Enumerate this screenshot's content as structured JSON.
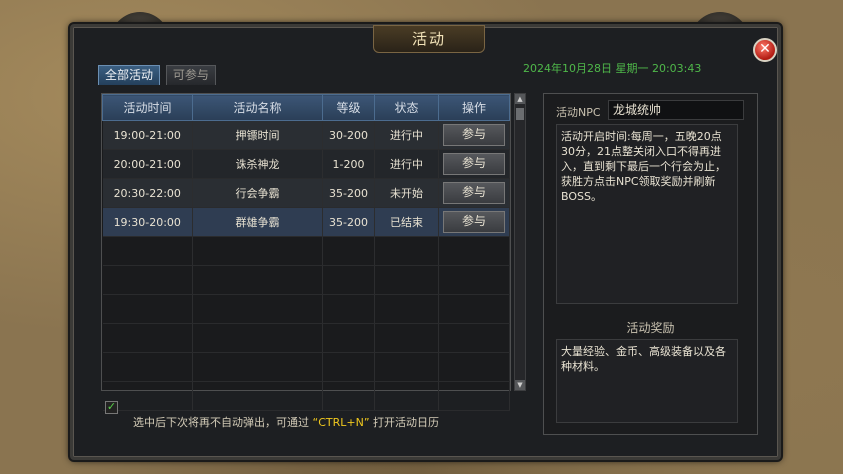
{
  "window": {
    "title": "活动",
    "close_label": "✕"
  },
  "tabs": [
    {
      "label": "全部活动",
      "active": true
    },
    {
      "label": "可参与",
      "active": false
    }
  ],
  "datetime": "2024年10月28日 星期一 20:03:43",
  "table": {
    "headers": [
      "活动时间",
      "活动名称",
      "等级",
      "状态",
      "操作"
    ],
    "rows": [
      {
        "time": "19:00-21:00",
        "name": "押镖时间",
        "level": "30-200",
        "status": "进行中",
        "status_color": "#f0c81e",
        "action": "参与"
      },
      {
        "time": "20:00-21:00",
        "name": "诛杀神龙",
        "level": "1-200",
        "status": "进行中",
        "status_color": "#f0c81e",
        "action": "参与"
      },
      {
        "time": "20:30-22:00",
        "name": "行会争霸",
        "level": "35-200",
        "status": "未开始",
        "status_color": "#8d8a83",
        "action": "参与"
      },
      {
        "time": "19:30-20:00",
        "name": "群雄争霸",
        "level": "35-200",
        "status": "已结束",
        "status_color": "#8d8a83",
        "action": "参与"
      }
    ]
  },
  "hint": {
    "prefix": "选中后下次将再不自动弹出，可通过",
    "shortcut": "“CTRL+N”",
    "suffix": "打开活动日历",
    "checked": true,
    "check_mark": "✓"
  },
  "npc": {
    "label": "活动NPC",
    "name": "龙城统帅"
  },
  "description": "活动开启时间:每周一，五晚20点30分，21点整关闭入口不得再进入，直到剩下最后一个行会为止，获胜方点击NPC领取奖励并刷新BOSS。",
  "reward": {
    "title": "活动奖励",
    "text": "大量经验、金币、高级装备以及各种材料。"
  },
  "scroll": {
    "up": "▲",
    "down": "▼"
  },
  "colors": {
    "active_status": "#f0c81e",
    "inactive_status": "#8d8a83",
    "datetime": "#4fb84a",
    "header": "#2a3e57"
  }
}
